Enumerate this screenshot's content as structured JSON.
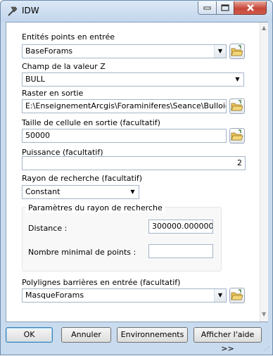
{
  "window": {
    "title": "IDW"
  },
  "fields": {
    "input_points": {
      "label": "Entités points en entrée",
      "value": "BaseForams"
    },
    "z_value": {
      "label": "Champ de la valeur Z",
      "value": "BULL"
    },
    "output_raster": {
      "label": "Raster en sortie",
      "value": "E:\\EnseignementArcgis\\Foraminiferes\\Seance\\Bulloides"
    },
    "cell_size": {
      "label": "Taille de cellule en sortie (facultatif)",
      "value": "50000"
    },
    "power": {
      "label": "Puissance (facultatif)",
      "value": "2"
    },
    "search_radius": {
      "label": "Rayon de recherche (facultatif)",
      "value": "Constant"
    },
    "radius_group": {
      "title": "Paramètres du rayon de recherche",
      "distance_label": "Distance :",
      "distance_value": "300000.000000",
      "min_points_label": "Nombre minimal de points :",
      "min_points_value": ""
    },
    "barriers": {
      "label": "Polylignes barrières en entrée (facultatif)",
      "value": "MasqueForams"
    }
  },
  "buttons": {
    "ok": "OK",
    "cancel": "Annuler",
    "environments": "Environnements",
    "help": "Afficher l'aide >>"
  },
  "icons": {
    "title": "hammer-icon",
    "folder": "open-folder-icon",
    "dropdown": "chevron-down-icon"
  }
}
